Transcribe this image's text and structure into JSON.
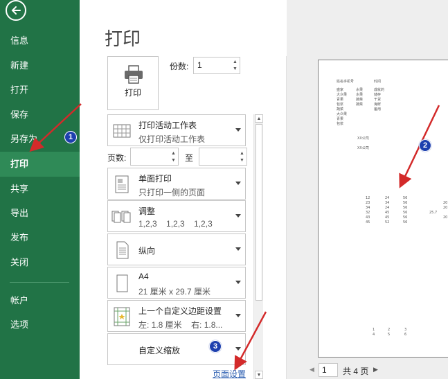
{
  "sidebar": {
    "items": [
      {
        "label": "信息"
      },
      {
        "label": "新建"
      },
      {
        "label": "打开"
      },
      {
        "label": "保存"
      },
      {
        "label": "另存为"
      },
      {
        "label": "打印"
      },
      {
        "label": "共享"
      },
      {
        "label": "导出"
      },
      {
        "label": "发布"
      },
      {
        "label": "关闭"
      },
      {
        "label": "帐户"
      },
      {
        "label": "选项"
      }
    ],
    "active": "打印"
  },
  "main": {
    "title": "打印",
    "print_button_label": "打印",
    "copies_label": "份数:",
    "copies_value": "1",
    "pages_label": "页数:",
    "pages_to_label": "至",
    "pages_from_value": "",
    "pages_to_value": "",
    "settings": [
      {
        "line1": "打印活动工作表",
        "line2": "仅打印活动工作表",
        "icon": "sheet-grid-icon"
      },
      {
        "line1": "单面打印",
        "line2": "只打印一侧的页面",
        "icon": "one-sided-icon"
      },
      {
        "line1": "调整",
        "line2": "1,2,3    1,2,3    1,2,3",
        "icon": "collated-icon"
      },
      {
        "line1": "纵向",
        "line2": "",
        "icon": "portrait-page-icon"
      },
      {
        "line1": "A4",
        "line2": "21 厘米 x 29.7 厘米",
        "icon": "paper-size-icon"
      },
      {
        "line1": "上一个自定义边距设置",
        "line2": "左: 1.8 厘米    右: 1.8...",
        "icon": "margins-icon"
      },
      {
        "line1": "自定义缩放",
        "line2": "",
        "icon": "scaling-icon"
      }
    ],
    "page_setup_link": "页面设置"
  },
  "preview": {
    "current_page": "1",
    "total_pages": "共 4 页",
    "header_row": [
      "姓名手机号",
      "时间"
    ],
    "names": [
      [
        "盛家",
        "水果",
        "成就的"
      ],
      [
        "大众果",
        "水果",
        "储存"
      ],
      [
        "青果",
        "蔬菜",
        "干货"
      ],
      [
        "包浆",
        "蔬菜",
        "海鲜"
      ],
      [
        "蔬菜",
        "",
        "备用"
      ],
      [
        "大众果",
        "",
        ""
      ],
      [
        "青果",
        "",
        ""
      ],
      [
        "包浆",
        "",
        ""
      ]
    ],
    "notes": [
      "XX公司",
      "XX公司"
    ],
    "numbers": [
      [
        "12",
        "24",
        "56"
      ],
      [
        "23",
        "34",
        "56"
      ],
      [
        "34",
        "24",
        "56"
      ],
      [
        "32",
        "45",
        "56"
      ],
      [
        "43",
        "45",
        "56"
      ],
      [
        "45",
        "52",
        "56"
      ]
    ],
    "right_col": [
      "20",
      "20",
      "25.7",
      "20"
    ],
    "footer_numbers": [
      [
        "1",
        "2",
        "3"
      ],
      [
        "4",
        "5",
        "6"
      ]
    ]
  },
  "annotations": {
    "badge1": "1",
    "badge2": "2",
    "badge3": "3"
  },
  "colors": {
    "sidebar": "#217346",
    "active_item": "#2f8a57",
    "arrow": "#d32a2a",
    "badge": "#1d3fae",
    "link": "#2a5db0"
  }
}
